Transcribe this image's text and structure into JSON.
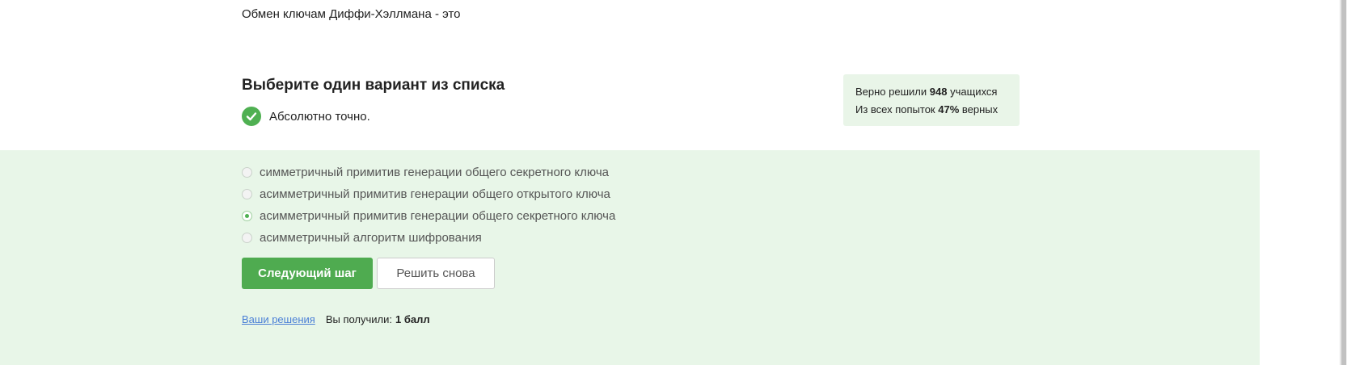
{
  "question": {
    "text": "Обмен ключам Диффи-Хэллмана - это"
  },
  "task": {
    "heading": "Выберите один вариант из списка",
    "feedback": "Абсолютно точно."
  },
  "stats": {
    "line1_prefix": "Верно решили",
    "solved_count": "948",
    "line1_suffix": "учащихся",
    "line2_prefix": "Из всех попыток",
    "correct_percent": "47%",
    "line2_suffix": "верных"
  },
  "options": [
    {
      "label": "симметричный примитив генерации общего секретного ключа",
      "selected": false
    },
    {
      "label": "асимметричный примитив генерации общего открытого ключа",
      "selected": false
    },
    {
      "label": "асимметричный примитив генерации общего секретного ключа",
      "selected": true
    },
    {
      "label": "асимметричный алгоритм шифрования",
      "selected": false
    }
  ],
  "actions": {
    "next_label": "Следующий шаг",
    "retry_label": "Решить снова"
  },
  "footer": {
    "solutions_link": "Ваши решения",
    "score_label": "Вы получили:",
    "score_value": "1 балл"
  },
  "colors": {
    "accent_green": "#4fab50",
    "success_bg": "#e8f6e8",
    "link_blue": "#4a7fd6"
  },
  "icons": {
    "feedback": "check-circle-icon"
  }
}
